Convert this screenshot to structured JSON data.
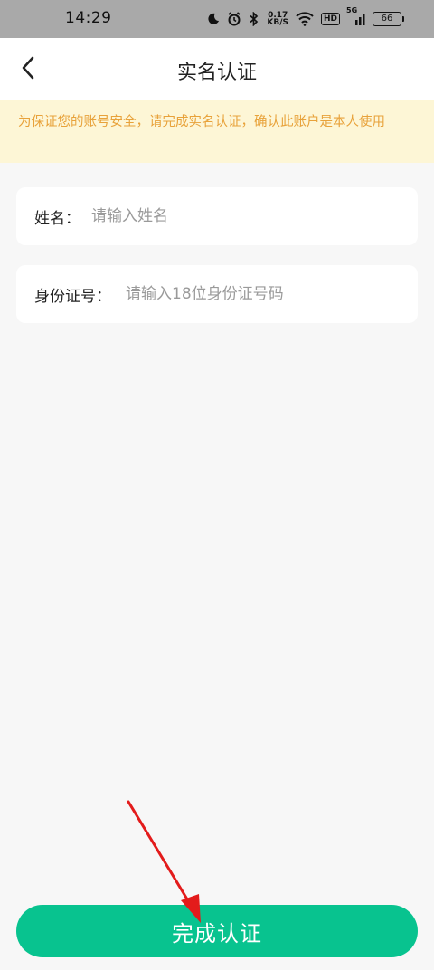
{
  "status_bar": {
    "time": "14:29",
    "network_speed_value": "0.17",
    "network_speed_unit": "KB/S",
    "hd_badge": "HD",
    "signal_label": "5G",
    "battery_level": "66",
    "icons": [
      "moon-icon",
      "alarm-icon",
      "bluetooth-icon",
      "wifi-icon",
      "signal-icon",
      "battery-icon"
    ]
  },
  "navbar": {
    "title": "实名认证"
  },
  "notice": {
    "text": "为保证您的账号安全，请完成实名认证，确认此账户是本人使用"
  },
  "form": {
    "name_label": "姓名：",
    "name_placeholder": "请输入姓名",
    "id_label": "身份证号：",
    "id_placeholder": "请输入18位身份证号码"
  },
  "submit_label": "完成认证",
  "colors": {
    "status_bar_bg": "#a9a9a9",
    "notice_bg": "#fdf6d6",
    "notice_text": "#e8a23a",
    "page_bg": "#f7f7f7",
    "primary_button": "#08c38f",
    "annotation_arrow": "#e31b1b"
  }
}
